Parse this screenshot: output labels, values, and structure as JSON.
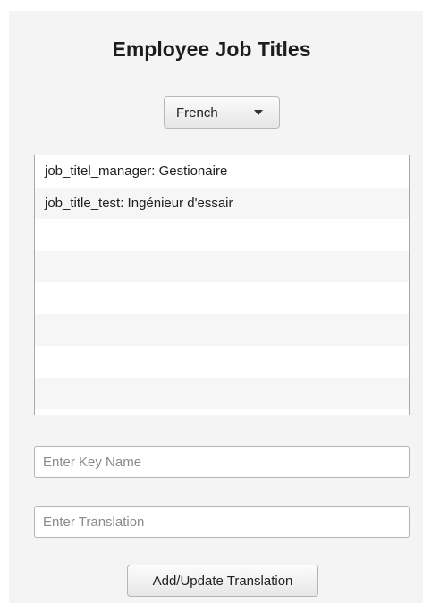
{
  "header": {
    "title": "Employee Job Titles"
  },
  "language_select": {
    "selected": "French",
    "icon": "chevron-down-icon"
  },
  "translations": {
    "rows": [
      {
        "text": "job_titel_manager: Gestionaire"
      },
      {
        "text": "job_title_test: Ingénieur d'essair"
      },
      {
        "text": ""
      },
      {
        "text": ""
      },
      {
        "text": ""
      },
      {
        "text": ""
      },
      {
        "text": ""
      },
      {
        "text": ""
      }
    ]
  },
  "form": {
    "key_field": {
      "value": "",
      "placeholder": "Enter Key Name"
    },
    "translation_field": {
      "value": "",
      "placeholder": "Enter Translation"
    },
    "submit_label": "Add/Update Translation"
  }
}
